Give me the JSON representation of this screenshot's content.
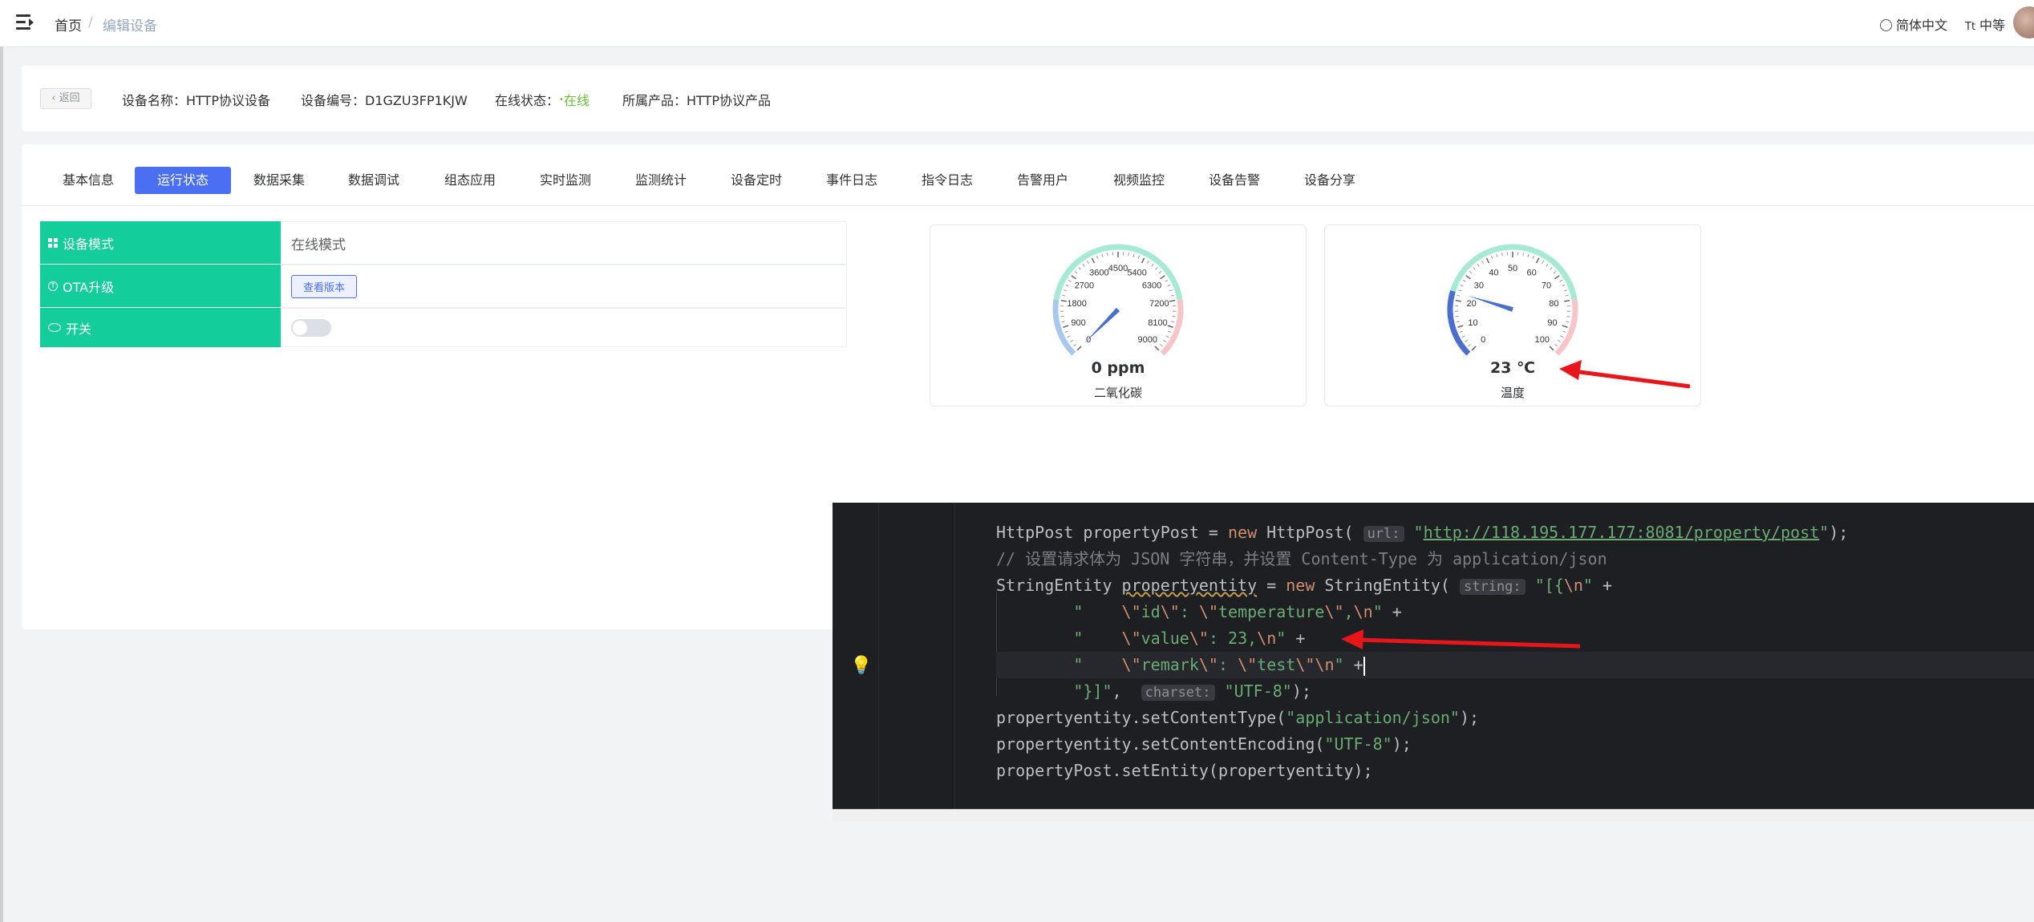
{
  "header": {
    "breadcrumb": {
      "home": "首页",
      "separator": "/",
      "current": "编辑设备"
    },
    "language": "简体中文",
    "font_size": "中等"
  },
  "device_info": {
    "back_label": "返回",
    "name_label": "设备名称：",
    "name": "HTTP协议设备",
    "id_label": "设备编号：",
    "id": "D1GZU3FP1KJW",
    "status_label": "在线状态：",
    "status": "在线",
    "product_label": "所属产品：",
    "product": "HTTP协议产品"
  },
  "tabs": [
    {
      "label": "基本信息",
      "active": false
    },
    {
      "label": "运行状态",
      "active": true
    },
    {
      "label": "数据采集",
      "active": false
    },
    {
      "label": "数据调试",
      "active": false
    },
    {
      "label": "组态应用",
      "active": false
    },
    {
      "label": "实时监测",
      "active": false
    },
    {
      "label": "监测统计",
      "active": false
    },
    {
      "label": "设备定时",
      "active": false
    },
    {
      "label": "事件日志",
      "active": false
    },
    {
      "label": "指令日志",
      "active": false
    },
    {
      "label": "告警用户",
      "active": false
    },
    {
      "label": "视频监控",
      "active": false
    },
    {
      "label": "设备告警",
      "active": false
    },
    {
      "label": "设备分享",
      "active": false
    }
  ],
  "status_table": {
    "rows": [
      {
        "label": "设备模式",
        "value": "在线模式",
        "icon": "grid-icon"
      },
      {
        "label": "OTA升级",
        "button": "查看版本",
        "icon": "upload-icon"
      },
      {
        "label": "开关",
        "switch_on": false,
        "icon": "eye-icon"
      }
    ]
  },
  "gauges": [
    {
      "name": "二氧化碳",
      "value": 0,
      "unit": "ppm",
      "display": "0 ppm",
      "min": 0,
      "max": 9000,
      "ticks": [
        "0",
        "900",
        "1800",
        "2700",
        "3600",
        "4500",
        "5400",
        "6300",
        "7200",
        "8100",
        "9000"
      ]
    },
    {
      "name": "温度",
      "value": 23,
      "unit": "℃",
      "display": "23 ℃",
      "min": 0,
      "max": 100,
      "ticks": [
        "0",
        "10",
        "20",
        "30",
        "40",
        "50",
        "60",
        "70",
        "80",
        "90",
        "100"
      ]
    }
  ],
  "code": {
    "lines": [
      "HttpPost propertyPost = new HttpPost( url: \"http://118.195.177.177:8081/property/post\");",
      "// 设置请求体为 JSON 字符串，并设置 Content-Type 为 application/json",
      "StringEntity propertyentity = new StringEntity( string: \"[{\\n\" +",
      "        \"    \\\"id\\\": \\\"temperature\\\",\\n\" +",
      "        \"    \\\"value\\\": 23,\\n\" +",
      "        \"    \\\"remark\\\": \\\"test\\\"\\n\" +",
      "        \"}]\",  charset: \"UTF-8\");",
      "propertyentity.setContentType(\"application/json\");",
      "propertyentity.setContentEncoding(\"UTF-8\");",
      "propertyPost.setEntity(propertyentity);"
    ],
    "hint_url": "url:",
    "hint_string": "string:",
    "hint_charset": "charset:"
  },
  "colors": {
    "accent": "#4b6ff2",
    "table_label": "#13ce9a",
    "online": "#67c23a",
    "arrow": "#e8161b",
    "editor_bg": "#1e1f22"
  }
}
